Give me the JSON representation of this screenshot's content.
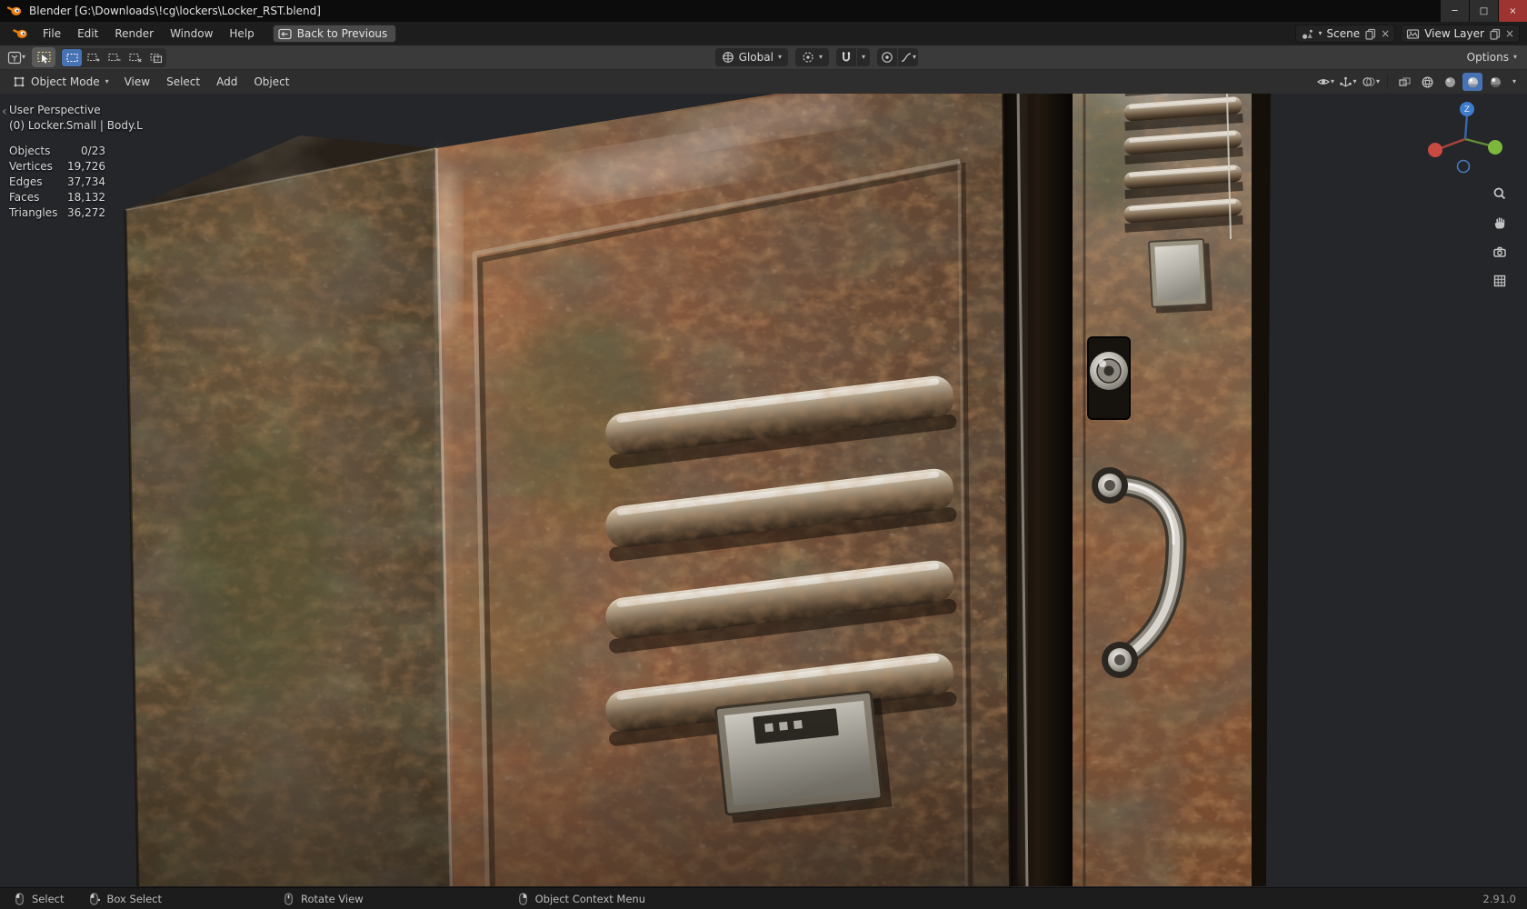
{
  "icons": {
    "chevron_down": "▾",
    "minimize": "─",
    "maximize": "□",
    "close": "×",
    "sidebar_tab": "‹"
  },
  "window": {
    "title": "Blender [G:\\Downloads\\!cg\\lockers\\Locker_RST.blend]"
  },
  "topbar": {
    "menus": [
      "File",
      "Edit",
      "Render",
      "Window",
      "Help"
    ],
    "back_button": "Back to Previous",
    "scene": {
      "label": "Scene"
    },
    "view_layer": {
      "label": "View Layer"
    }
  },
  "tool_header": {
    "orientation": "Global",
    "options": "Options"
  },
  "object_header": {
    "mode": "Object Mode",
    "menus": [
      "View",
      "Select",
      "Add",
      "Object"
    ]
  },
  "viewport": {
    "perspective": "User Perspective",
    "active_object": "(0) Locker.Small | Body.L",
    "gizmo_z": "Z",
    "stats": [
      {
        "label": "Objects",
        "value": "0/23"
      },
      {
        "label": "Vertices",
        "value": "19,726"
      },
      {
        "label": "Edges",
        "value": "37,734"
      },
      {
        "label": "Faces",
        "value": "18,132"
      },
      {
        "label": "Triangles",
        "value": "36,272"
      }
    ]
  },
  "statusbar": {
    "hints": [
      {
        "label": "Select"
      },
      {
        "label": "Box Select"
      },
      {
        "label": "Rotate View"
      },
      {
        "label": "Object Context Menu"
      }
    ],
    "version": "2.91.0"
  },
  "colors": {
    "accent": "#4772b3",
    "header": "#3a3a3a",
    "subheader": "#2e2e2e",
    "viewport_bg": "#25262a",
    "rust": "#8a5a40"
  }
}
